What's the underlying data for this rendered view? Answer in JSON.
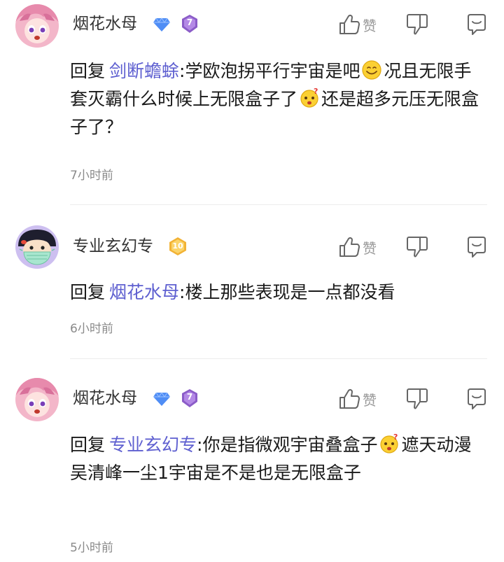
{
  "actions": {
    "like_label": "赞"
  },
  "comments": [
    {
      "username": "烟花水母",
      "level_badge": "7",
      "reply_prefix": "回复",
      "reply_to": "剑断蟾蜍",
      "text_part1": ":学欧泡拐平行宇宙是吧",
      "text_part2": "况且无限手套灭霸什么时候上无限盒子了",
      "text_part3": "还是超多元压无限盒子了？",
      "time": "7小时前"
    },
    {
      "username": "专业玄幻专",
      "level_badge": "10",
      "reply_prefix": "回复",
      "reply_to": "烟花水母",
      "text_part1": ":楼上那些表现是一点都没看",
      "time": "6小时前"
    },
    {
      "username": "烟花水母",
      "level_badge": "7",
      "reply_prefix": "回复",
      "reply_to": "专业玄幻专",
      "text_part1": ":你是指微观宇宙叠盒子",
      "text_part2": "遮天动漫吴清峰一尘1宇宙是不是也是无限盒子",
      "time": "5小时前"
    }
  ],
  "colors": {
    "mention": "#5e5fd0",
    "time": "#8a8a8a",
    "diamond_badge": "#4f8df5",
    "level_badge_purple": "#8b5cc8",
    "level_badge_gold": "#f2b234"
  },
  "icons": [
    "avatar-anime-girl",
    "avatar-mask-boy",
    "diamond-badge-icon",
    "level-badge-icon",
    "thumbs-up-icon",
    "thumbs-down-icon",
    "comment-icon",
    "smile-emoji",
    "thinking-emoji"
  ]
}
